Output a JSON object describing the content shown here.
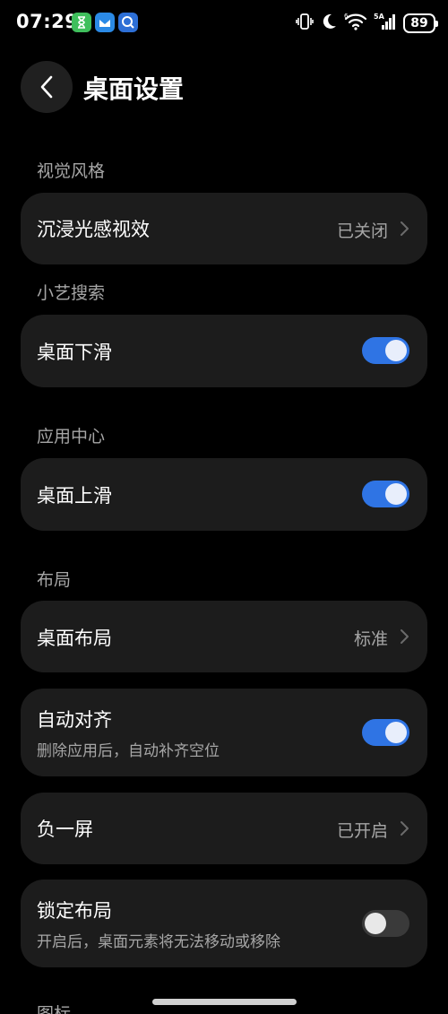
{
  "status_bar": {
    "time": "07:29",
    "battery": "89",
    "network_label": "5A",
    "icons": [
      "vibrate-icon",
      "moon-icon",
      "wifi-icon",
      "signal-icon",
      "battery-icon"
    ]
  },
  "header": {
    "title": "桌面设置"
  },
  "sections": {
    "visual_style": {
      "label": "视觉风格",
      "immersive": {
        "title": "沉浸光感视效",
        "value": "已关闭"
      }
    },
    "xiaoyi_search": {
      "label": "小艺搜索",
      "swipe_down": {
        "title": "桌面下滑",
        "enabled": true
      }
    },
    "app_center": {
      "label": "应用中心",
      "swipe_up": {
        "title": "桌面上滑",
        "enabled": true
      }
    },
    "layout": {
      "label": "布局",
      "desktop_layout": {
        "title": "桌面布局",
        "value": "标准"
      },
      "auto_align": {
        "title": "自动对齐",
        "subtitle": "删除应用后，自动补齐空位",
        "enabled": true
      },
      "minus_one_screen": {
        "title": "负一屏",
        "value": "已开启"
      },
      "lock_layout": {
        "title": "锁定布局",
        "subtitle": "开启后，桌面元素将无法移动或移除",
        "enabled": false
      }
    },
    "icons": {
      "label": "图标"
    }
  },
  "colors": {
    "background": "#000000",
    "card": "#1c1c1c",
    "accent": "#2f74e4",
    "secondary_text": "#a6a6a6"
  }
}
